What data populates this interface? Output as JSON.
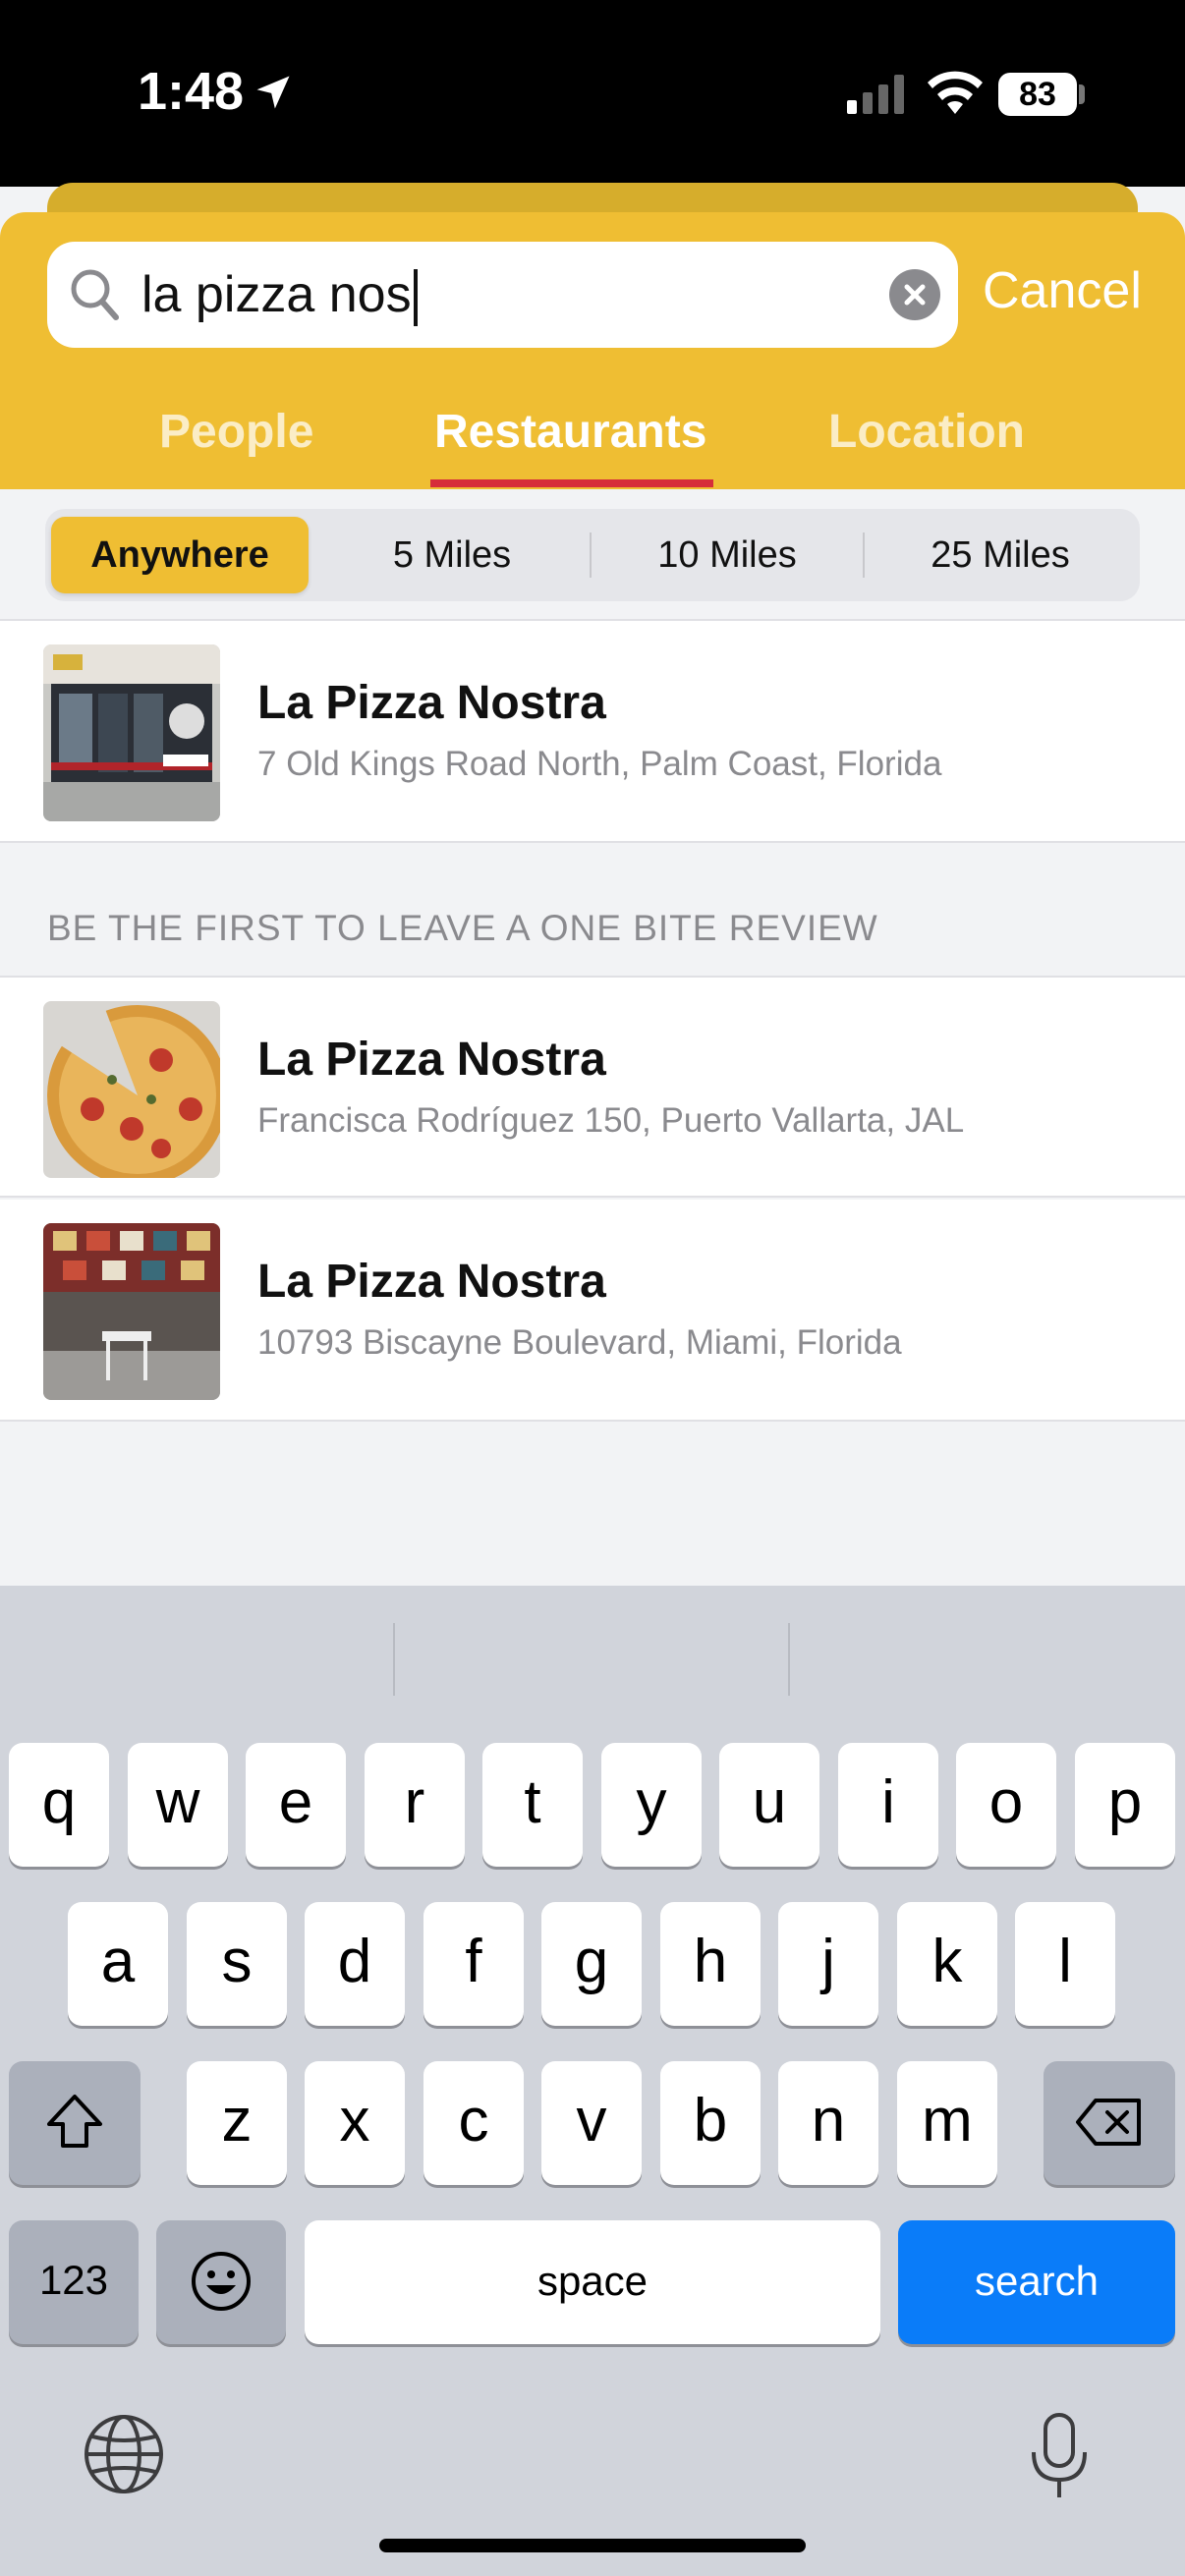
{
  "status_bar": {
    "time": "1:48",
    "battery": "83"
  },
  "search": {
    "query": "la pizza nos",
    "cancel_label": "Cancel"
  },
  "tabs": [
    {
      "label": "People"
    },
    {
      "label": "Restaurants"
    },
    {
      "label": "Location"
    }
  ],
  "distance_filter": {
    "options": [
      "Anywhere",
      "5 Miles",
      "10 Miles",
      "25 Miles"
    ],
    "selected": "Anywhere"
  },
  "results": [
    {
      "name": "La Pizza Nostra",
      "address": "7 Old Kings Road North, Palm Coast, Florida"
    }
  ],
  "section_header": "BE THE FIRST TO LEAVE A ONE BITE REVIEW",
  "unreviewed_results": [
    {
      "name": "La Pizza Nostra",
      "address": "Francisca Rodríguez 150, Puerto Vallarta, JAL"
    },
    {
      "name": "La Pizza Nostra",
      "address": "10793 Biscayne Boulevard, Miami, Florida"
    }
  ],
  "keyboard": {
    "row1": [
      "q",
      "w",
      "e",
      "r",
      "t",
      "y",
      "u",
      "i",
      "o",
      "p"
    ],
    "row2": [
      "a",
      "s",
      "d",
      "f",
      "g",
      "h",
      "j",
      "k",
      "l"
    ],
    "row3": [
      "z",
      "x",
      "c",
      "v",
      "b",
      "n",
      "m"
    ],
    "numbers_label": "123",
    "space_label": "space",
    "search_label": "search"
  },
  "colors": {
    "brand_yellow": "#efbe33",
    "tab_underline": "#d62d3a",
    "search_key": "#0a7cf9"
  }
}
